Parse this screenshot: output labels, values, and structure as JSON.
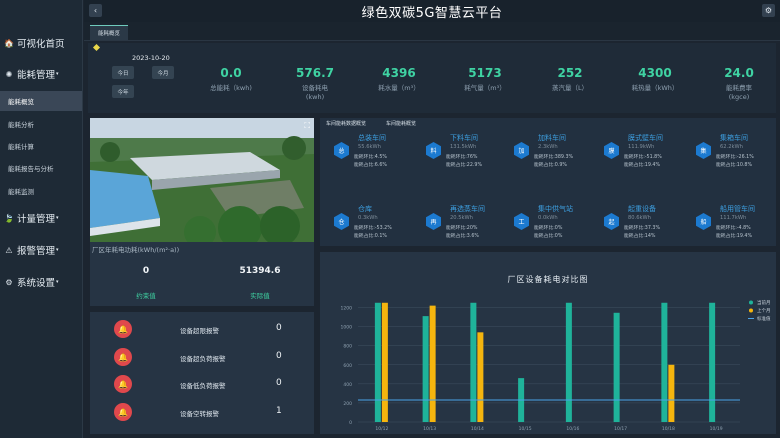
{
  "app": {
    "title": "绿色双碳5G智慧云平台"
  },
  "topbar": {
    "back_icon": "‹",
    "settings_icon": "⚙"
  },
  "sidebar": {
    "items": [
      {
        "label": "可视化首页",
        "icon": "🏠"
      },
      {
        "label": "能耗管理",
        "icon": "✺",
        "caret": "▾"
      },
      {
        "label": "计量管理",
        "icon": "🍃",
        "caret": "▾"
      },
      {
        "label": "报警管理",
        "icon": "⚠",
        "caret": "▾"
      },
      {
        "label": "系统设置",
        "icon": "⚙",
        "caret": "▾"
      }
    ],
    "subitems": [
      "能耗概览",
      "能耗分析",
      "能耗计算",
      "能耗报告与分析",
      "能耗监测"
    ]
  },
  "tabs": [
    {
      "label": "能耗概览"
    }
  ],
  "summary": {
    "date": "2023-10-20",
    "buttons": [
      "今日",
      "今月",
      "今年"
    ],
    "stats": [
      {
        "value": "0.0",
        "label": "总能耗（kwh)"
      },
      {
        "value": "576.7",
        "label": "设备耗电\n(kwh)"
      },
      {
        "value": "4396",
        "label": "耗水量（m³）"
      },
      {
        "value": "5173",
        "label": "耗气量（m³）"
      },
      {
        "value": "252",
        "label": "蒸汽量（L）"
      },
      {
        "value": "4300",
        "label": "耗热量（kWh）"
      },
      {
        "value": "24.0",
        "label": "能耗费率\n(kgce)"
      }
    ]
  },
  "factory": {
    "unit_label": "厂区年耗电功耗(kWh/(m²·a))",
    "plan_value": "0",
    "plan_label": "约束值",
    "actual_value": "51394.6",
    "actual_label": "实际值",
    "expand_icon": "⛶"
  },
  "workshops": {
    "tabs": [
      "车间能耗数据概览",
      "车间能耗概览"
    ],
    "items": [
      {
        "name": "总装车间",
        "kwh": "55.6kWh",
        "r1": "能耗环比:4.5%",
        "r2": "能耗占比:6.6%",
        "icon": "总"
      },
      {
        "name": "下料车间",
        "kwh": "131.5kWh",
        "r1": "能耗环比:76%",
        "r2": "能耗占比:22.9%",
        "icon": "料"
      },
      {
        "name": "加料车间",
        "kwh": "2.3kWh",
        "r1": "能耗环比:389.3%",
        "r2": "能耗占比:0.9%",
        "icon": "加"
      },
      {
        "name": "膜式壁车间",
        "kwh": "111.9kWh",
        "r1": "能耗环比:-51.8%",
        "r2": "能耗占比:19.4%",
        "icon": "膜"
      },
      {
        "name": "集箱车间",
        "kwh": "62.2kWh",
        "r1": "能耗环比:-26.1%",
        "r2": "能耗占比:10.8%",
        "icon": "集"
      },
      {
        "name": "仓库",
        "kwh": "0.3kWh",
        "r1": "能耗环比:-53.2%",
        "r2": "能耗占比:0.1%",
        "icon": "仓"
      },
      {
        "name": "再选蒸车间",
        "kwh": "20.5kWh",
        "r1": "能耗环比:20%",
        "r2": "能耗占比:3.6%",
        "icon": "再"
      },
      {
        "name": "集中供气站",
        "kwh": "0.0kWh",
        "r1": "能耗环比:0%",
        "r2": "能耗占比:0%",
        "icon": "工"
      },
      {
        "name": "起重设备",
        "kwh": "80.6kWh",
        "r1": "能耗环比:37.3%",
        "r2": "能耗占比:14%",
        "icon": "起"
      },
      {
        "name": "船用管车间",
        "kwh": "111.7kWh",
        "r1": "能耗环比:-4.8%",
        "r2": "能耗占比:19.4%",
        "icon": "船"
      }
    ]
  },
  "alarms": [
    {
      "label": "设备超限报警",
      "value": "0"
    },
    {
      "label": "设备超负荷报警",
      "value": "0"
    },
    {
      "label": "设备低负荷报警",
      "value": "0"
    },
    {
      "label": "设备空转报警",
      "value": "1"
    }
  ],
  "chart_data": {
    "type": "bar",
    "title": "厂区设备耗电对比图",
    "categories": [
      "10/12",
      "10/13",
      "10/14",
      "10/15",
      "10/16",
      "10/17",
      "10/18",
      "10/19"
    ],
    "series": [
      {
        "name": "当前月",
        "values": [
          1250,
          1110,
          1250,
          460,
          1250,
          1145,
          1250,
          1250
        ],
        "color": "#1fb39a"
      },
      {
        "name": "上个月",
        "values": [
          1250,
          1220,
          940,
          0,
          0,
          0,
          600,
          0
        ],
        "color": "#f5b50e"
      }
    ],
    "line_series": {
      "name": "标准值",
      "value": 230,
      "color": "#4aa3e8"
    },
    "yticks": [
      0,
      200,
      400,
      600,
      800,
      1000,
      1200
    ],
    "ylim": [
      0,
      1300
    ]
  },
  "colors": {
    "accent": "#3fd3a3",
    "bg": "#1c2530",
    "panel": "#243140",
    "workshop": "#3d9fe0",
    "alarm": "#e0484c"
  }
}
